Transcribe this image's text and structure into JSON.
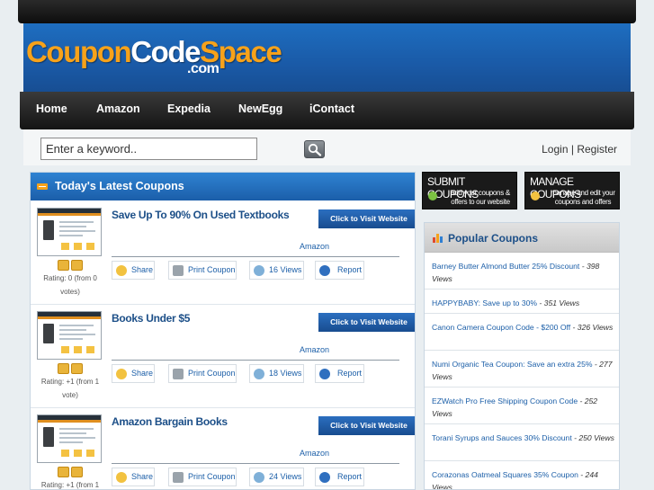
{
  "logo": {
    "part1": "Coupon",
    "part2": "Code",
    "part3": "Space",
    "tld": ".com",
    "colors": {
      "orange": "#f7a21a",
      "white": "#ffffff",
      "blue": "#1a5aa7"
    }
  },
  "nav": {
    "items": [
      "Home",
      "Amazon",
      "Expedia",
      "NewEgg",
      "iContact"
    ]
  },
  "search": {
    "value": "Enter a keyword..",
    "button_icon": "magnifier-icon"
  },
  "auth": {
    "login": "Login",
    "separator": "|",
    "register": "Register"
  },
  "main": {
    "title": "Today's Latest Coupons",
    "badge_icon": "new-badge-icon",
    "coupons": [
      {
        "title": "Save Up To 90% On Used Textbooks",
        "visit": "Click to Visit Website",
        "merchant": "Amazon",
        "share": "Share",
        "print": "Print Coupon",
        "views": "16 Views",
        "report": "Report",
        "rating_line1": "Rating: 0 (from 0",
        "rating_line2": "votes)"
      },
      {
        "title": "Books Under $5",
        "visit": "Click to Visit Website",
        "merchant": "Amazon",
        "share": "Share",
        "print": "Print Coupon",
        "views": "18 Views",
        "report": "Report",
        "rating_line1": "Rating: +1 (from 1",
        "rating_line2": "vote)"
      },
      {
        "title": "Amazon Bargain Books",
        "visit": "Click to Visit Website",
        "merchant": "Amazon",
        "share": "Share",
        "print": "Print Coupon",
        "views": "24 Views",
        "report": "Report",
        "rating_line1": "Rating: +1 (from 1",
        "rating_line2": ""
      }
    ]
  },
  "sidebar": {
    "submit": {
      "title": "SUBMIT COUPONS",
      "line1": "add your coupons &",
      "line2": "offers to our website"
    },
    "manage": {
      "title": "MANAGE COUPONS",
      "line1": "manage and edit your",
      "line2": "coupons and offers"
    },
    "popular_title": "Popular Coupons",
    "popular": [
      {
        "text": "Barney Butter Almond Butter 25% Discount",
        "views": " - 398 Views"
      },
      {
        "text": "HAPPYBABY: Save up to 30%",
        "views": " - 351 Views"
      },
      {
        "text": "Canon Camera Coupon Code - $200 Off",
        "views": " - 326 Views"
      },
      {
        "text": "Numi Organic Tea Coupon: Save an extra 25%",
        "views": " - 277 Views"
      },
      {
        "text": "EZWatch Pro Free Shipping Coupon Code",
        "views": " - 252 Views"
      },
      {
        "text": "Torani Syrups and Sauces 30% Discount",
        "views": " - 250 Views"
      },
      {
        "text": "Corazonas Oatmeal Squares 35% Coupon",
        "views": " - 244 Views"
      }
    ]
  }
}
